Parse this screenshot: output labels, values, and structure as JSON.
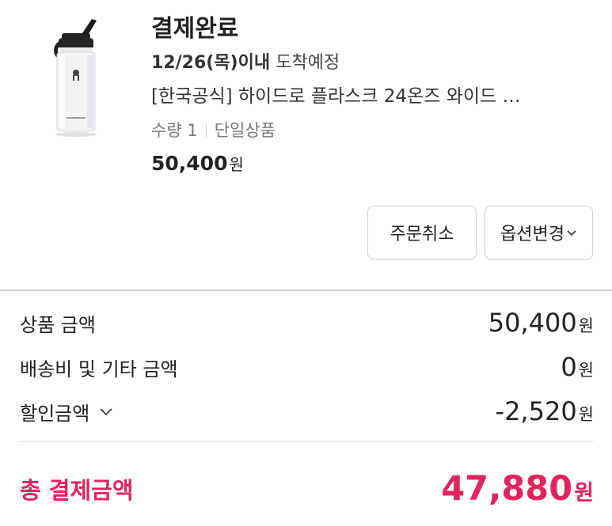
{
  "order": {
    "status": "결제완료",
    "delivery_date": "12/26(목)이내",
    "delivery_label": "도착예정",
    "product_name": "[한국공식] 하이드로 플라스크 24온즈 와이드 …",
    "quantity": "수량 1",
    "option": "단일상품",
    "price": "50,400",
    "currency": "원"
  },
  "actions": {
    "cancel_label": "주문취소",
    "change_option_label": "옵션변경"
  },
  "summary": {
    "product_amount_label": "상품 금액",
    "product_amount": "50,400",
    "shipping_label": "배송비 및 기타 금액",
    "shipping_amount": "0",
    "discount_label": "할인금액",
    "discount_amount": "-2,520",
    "currency": "원"
  },
  "total": {
    "label": "총 결제금액",
    "amount": "47,880",
    "currency": "원"
  },
  "colors": {
    "accent": "#e0245e",
    "text": "#222222",
    "muted": "#777777",
    "border": "#d2d2d2"
  },
  "icons": {
    "product_image": "water-bottle-image",
    "dropdown": "chevron-down-icon"
  }
}
